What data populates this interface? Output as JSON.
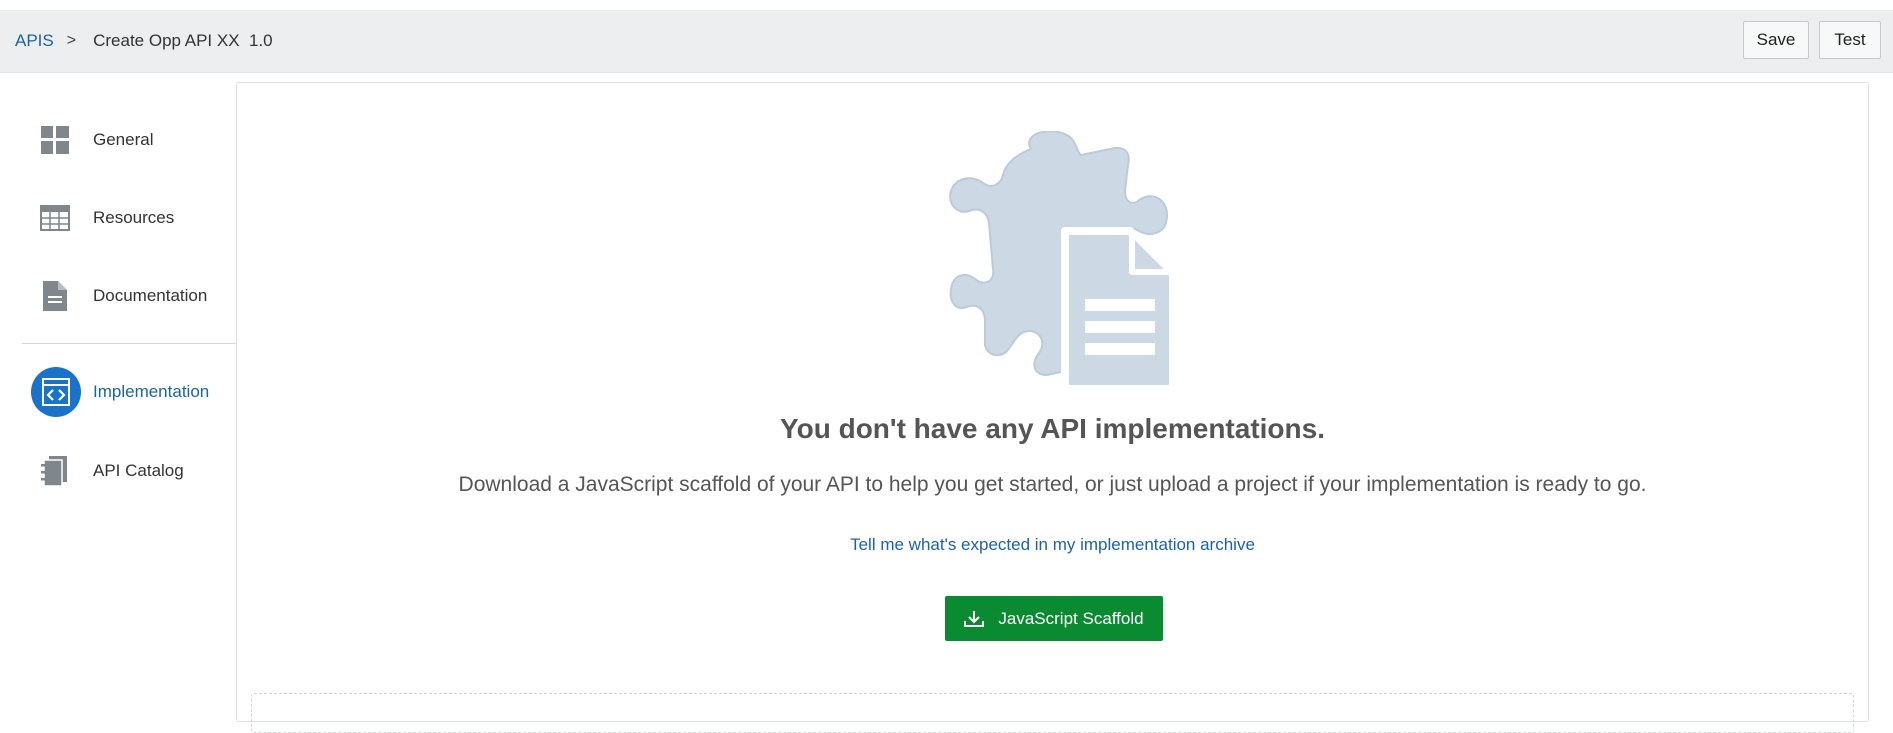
{
  "header": {
    "breadcrumb_root": "APIS",
    "breadcrumb_separator": ">",
    "breadcrumb_current": "Create Opp API XX  1.0",
    "save_label": "Save",
    "test_label": "Test"
  },
  "sidebar": {
    "items": [
      {
        "label": "General",
        "icon": "grid-icon"
      },
      {
        "label": "Resources",
        "icon": "table-icon"
      },
      {
        "label": "Documentation",
        "icon": "document-icon"
      },
      {
        "label": "Implementation",
        "icon": "code-icon",
        "active": true
      },
      {
        "label": "API Catalog",
        "icon": "catalog-icon"
      }
    ]
  },
  "main": {
    "illustration_icon": "puzzle-document-icon",
    "empty_title": "You don't have any API implementations.",
    "empty_description": "Download a JavaScript scaffold of your API to help you get started, or just upload a project if your implementation is ready to go.",
    "help_link": "Tell me what's expected in my implementation archive",
    "scaffold_button": "JavaScript Scaffold",
    "scaffold_icon": "download-icon"
  },
  "colors": {
    "accent": "#1a73c9",
    "link": "#1a63a8",
    "primary_button": "#0a8a31",
    "illustration": "#ccd8e4",
    "header_bg": "#eceeef"
  }
}
